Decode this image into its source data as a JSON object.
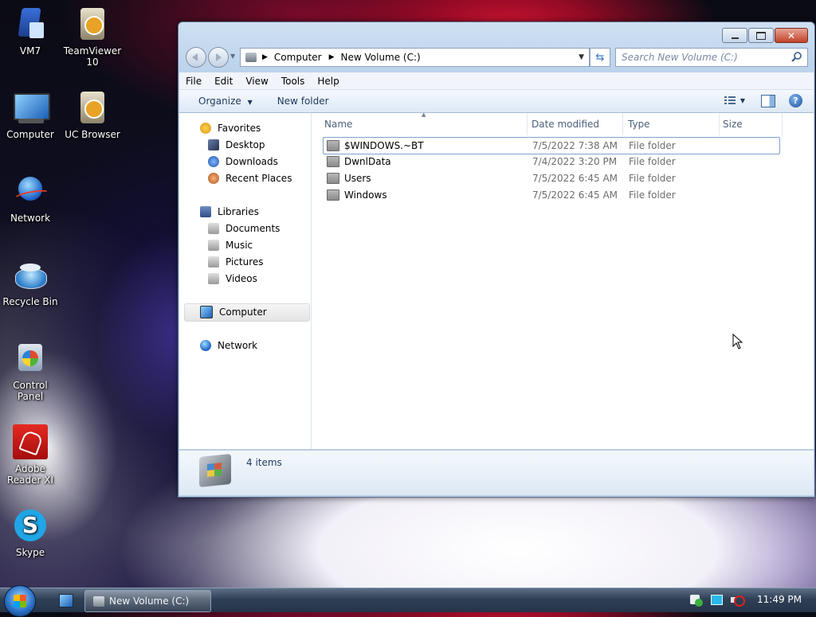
{
  "desktop": {
    "icons": [
      {
        "label": "VM7"
      },
      {
        "label": "TeamViewer 10"
      },
      {
        "label": "Computer"
      },
      {
        "label": "UC Browser"
      },
      {
        "label": "Network"
      },
      {
        "label": "Recycle Bin"
      },
      {
        "label": "Control Panel"
      },
      {
        "label": "Adobe Reader XI"
      },
      {
        "label": "Skype"
      }
    ]
  },
  "window": {
    "address": {
      "crumbs": [
        "Computer",
        "New Volume (C:)"
      ]
    },
    "search_placeholder": "Search New Volume (C:)",
    "menu": [
      "File",
      "Edit",
      "View",
      "Tools",
      "Help"
    ],
    "commands": {
      "organize": "Organize",
      "new_folder": "New folder"
    },
    "nav": {
      "favorites": "Favorites",
      "favorites_items": [
        "Desktop",
        "Downloads",
        "Recent Places"
      ],
      "libraries": "Libraries",
      "libraries_items": [
        "Documents",
        "Music",
        "Pictures",
        "Videos"
      ],
      "computer": "Computer",
      "network": "Network"
    },
    "columns": [
      "Name",
      "Date modified",
      "Type",
      "Size"
    ],
    "rows": [
      {
        "name": "$WINDOWS.~BT",
        "date": "7/5/2022 7:38 AM",
        "type": "File folder",
        "size": ""
      },
      {
        "name": "DwnlData",
        "date": "7/4/2022 3:20 PM",
        "type": "File folder",
        "size": ""
      },
      {
        "name": "Users",
        "date": "7/5/2022 6:45 AM",
        "type": "File folder",
        "size": ""
      },
      {
        "name": "Windows",
        "date": "7/5/2022 6:45 AM",
        "type": "File folder",
        "size": ""
      }
    ],
    "status": "4 items"
  },
  "taskbar": {
    "active_window": "New Volume (C:)",
    "clock": "11:49 PM"
  }
}
